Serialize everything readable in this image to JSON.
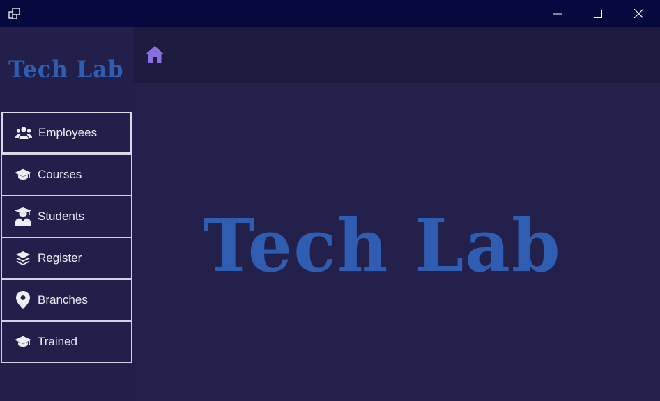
{
  "window": {
    "icons": {
      "app": "app-icon",
      "minimize": "minimize-icon",
      "maximize": "maximize-icon",
      "close": "close-icon"
    }
  },
  "sidebar": {
    "logo_text": "Tech Lab",
    "items": [
      {
        "label": "Employees",
        "icon": "users-icon"
      },
      {
        "label": "Courses",
        "icon": "graduation-cap-icon"
      },
      {
        "label": "Students",
        "icon": "student-icon"
      },
      {
        "label": "Register",
        "icon": "layers-icon"
      },
      {
        "label": "Branches",
        "icon": "map-pin-icon"
      },
      {
        "label": "Trained",
        "icon": "graduation-cap-icon"
      }
    ]
  },
  "topbar": {
    "home_icon": "home-icon"
  },
  "main": {
    "logo_text": "Tech Lab"
  },
  "colors": {
    "title_bar": "#06093d",
    "sidebar_bg": "#221f4a",
    "main_bg": "#23214c",
    "logo": "#2e5db1",
    "home_icon": "#8a6fe0",
    "nav_text": "#eceef6"
  }
}
